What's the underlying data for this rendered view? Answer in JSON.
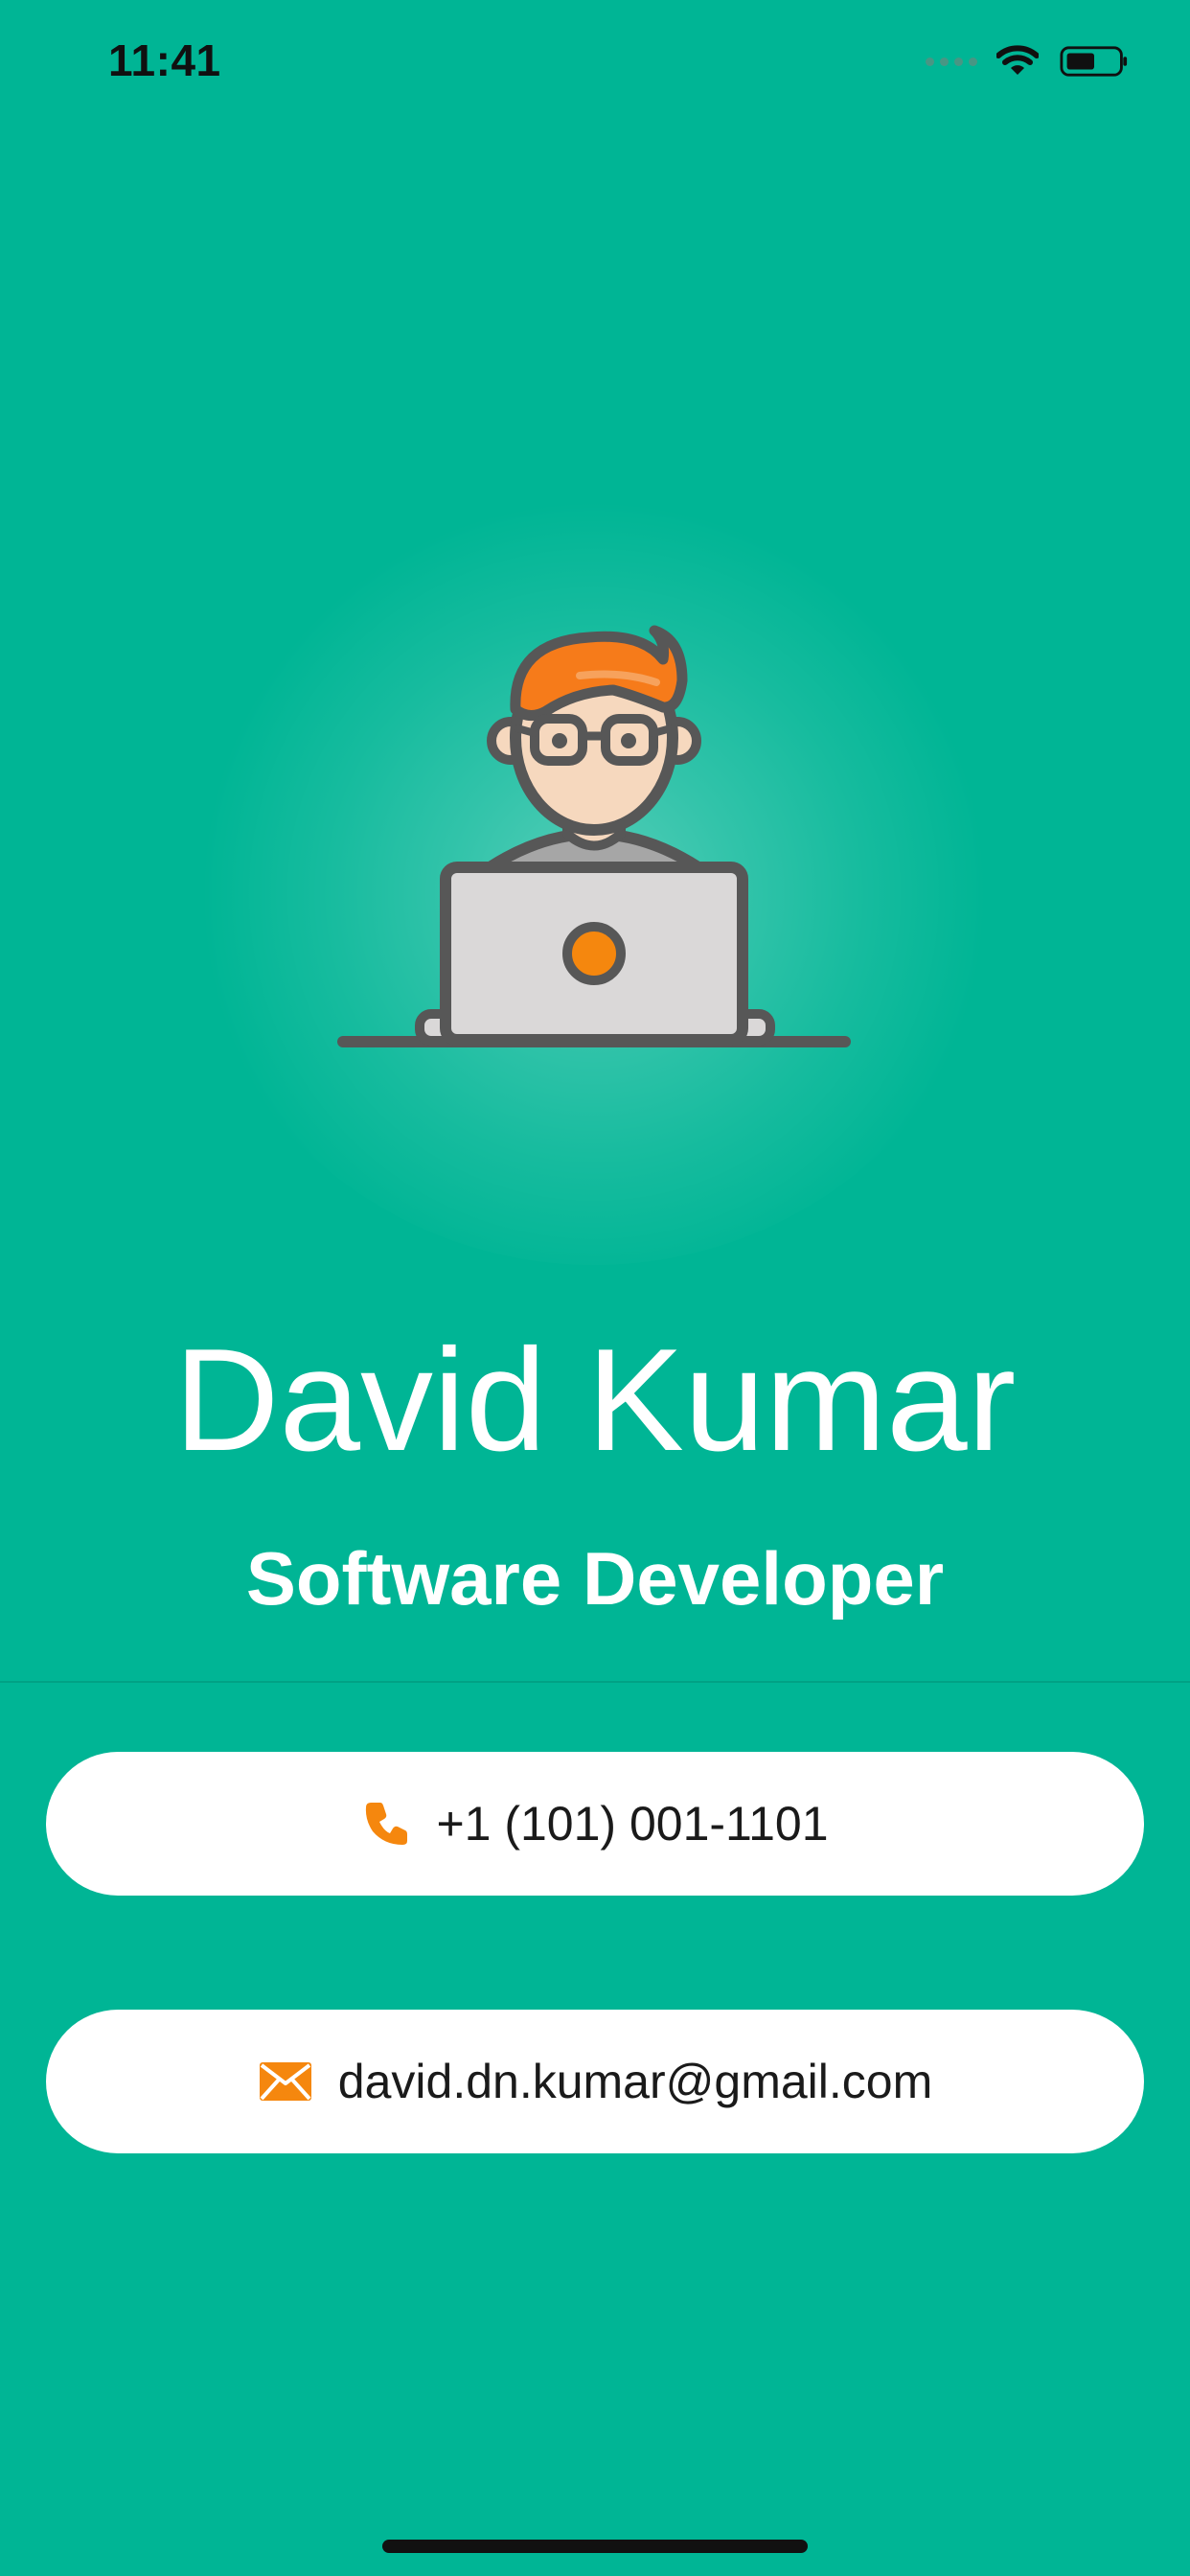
{
  "status_bar": {
    "time": "11:41"
  },
  "profile": {
    "name": "David Kumar",
    "title": "Software Developer",
    "avatar_icon": "developer-with-laptop-illustration"
  },
  "contacts": {
    "phone": {
      "icon": "phone-icon",
      "value": "+1 (101) 001-1101"
    },
    "email": {
      "icon": "envelope-icon",
      "value": "david.dn.kumar@gmail.com"
    }
  },
  "colors": {
    "background": "#00B595",
    "card": "#FFFFFF",
    "accent": "#F5870E",
    "text_primary": "#FFFFFF",
    "text_card": "#1A1A1A"
  }
}
